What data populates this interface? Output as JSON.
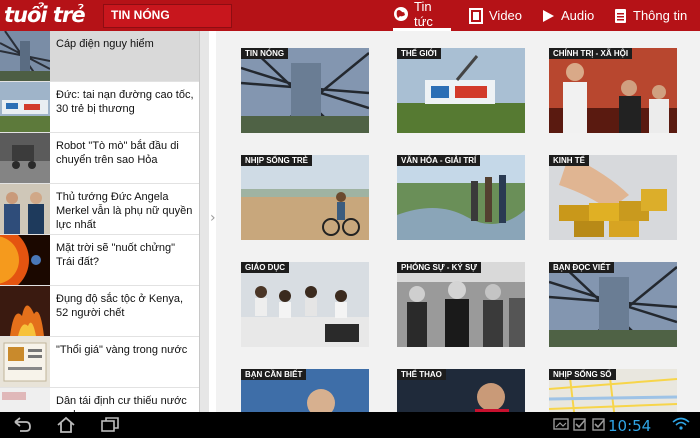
{
  "header": {
    "logo": "tuổi trẻ",
    "section_title": "TIN NÓNG",
    "tabs": [
      {
        "label": "Tin tức",
        "icon": "globe-icon",
        "active": true
      },
      {
        "label": "Video",
        "icon": "film-icon",
        "active": false
      },
      {
        "label": "Audio",
        "icon": "play-icon",
        "active": false
      },
      {
        "label": "Thông tin",
        "icon": "document-icon",
        "active": false
      }
    ]
  },
  "news_list": [
    {
      "title": "Cáp điện nguy hiểm",
      "selected": true
    },
    {
      "title": "Đức: tai nạn đường cao tốc, 30 trẻ bị thương",
      "selected": false
    },
    {
      "title": "Robot \"Tò mò\" bắt đầu di chuyển trên sao Hỏa",
      "selected": false
    },
    {
      "title": "Thủ tướng Đức Angela Merkel vẫn là phụ nữ quyền lực nhất",
      "selected": false
    },
    {
      "title": "Mặt trời sẽ \"nuốt chửng\" Trái đất?",
      "selected": false
    },
    {
      "title": "Đụng độ sắc tộc ở Kenya, 52 người chết",
      "selected": false
    },
    {
      "title": "\"Thổi giá\" vàng trong nước",
      "selected": false
    },
    {
      "title": "Dân tái định cư thiếu nước sạch",
      "selected": false
    }
  ],
  "categories": [
    {
      "label": "TIN NÓNG"
    },
    {
      "label": "THẾ GIỚI"
    },
    {
      "label": "CHÍNH TRỊ - XÃ HỘI"
    },
    {
      "label": "NHỊP SỐNG TRẺ"
    },
    {
      "label": "VĂN HÓA - GIẢI TRÍ"
    },
    {
      "label": "KINH TẾ"
    },
    {
      "label": "GIÁO DỤC"
    },
    {
      "label": "PHÓNG SỰ - KÝ SỰ"
    },
    {
      "label": "BẠN ĐỌC VIẾT"
    },
    {
      "label": "BẠN CẦN BIẾT"
    },
    {
      "label": "THỂ THAO"
    },
    {
      "label": "NHỊP SỐNG SỐ"
    }
  ],
  "status_bar": {
    "clock": "10:54",
    "icons": [
      "back-icon",
      "home-icon",
      "recent-apps-icon",
      "gallery-icon",
      "checkbox-icon",
      "checkbox-icon",
      "wifi-icon"
    ]
  },
  "colors": {
    "brand_red": "#b51217",
    "clock_blue": "#2fa5e6"
  }
}
